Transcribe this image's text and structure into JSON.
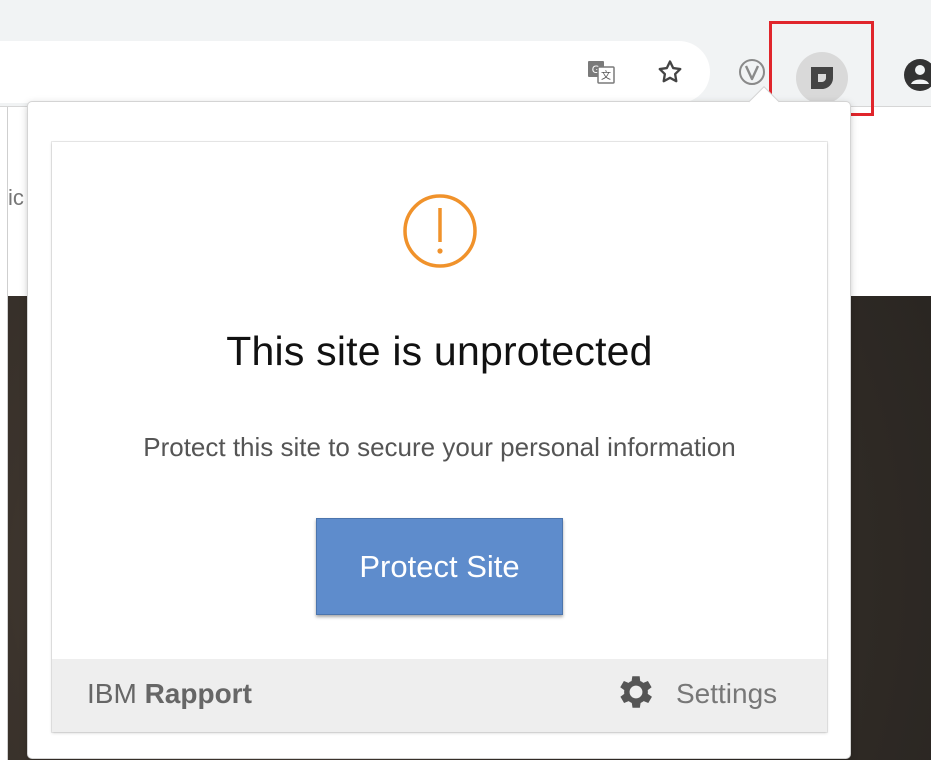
{
  "browser": {
    "toolbar_icons": {
      "translate": "translate-icon",
      "bookmark": "star-icon",
      "extension_v": "v-extension-icon",
      "extension_rapport": "rapport-extension-icon",
      "profile": "profile-icon"
    },
    "highlight_color": "#e0252b"
  },
  "page": {
    "fragment_text": "ic"
  },
  "popup": {
    "headline": "This site is unprotected",
    "subtext": "Protect this site to secure your personal information",
    "protect_button": "Protect Site",
    "warning_icon": "exclamation-circle-icon",
    "warning_color": "#f0922b",
    "button_color": "#5e8ccc",
    "footer": {
      "brand_prefix": "IBM",
      "brand_name": "Rapport",
      "settings_label": "Settings",
      "settings_icon": "gear-icon"
    }
  }
}
